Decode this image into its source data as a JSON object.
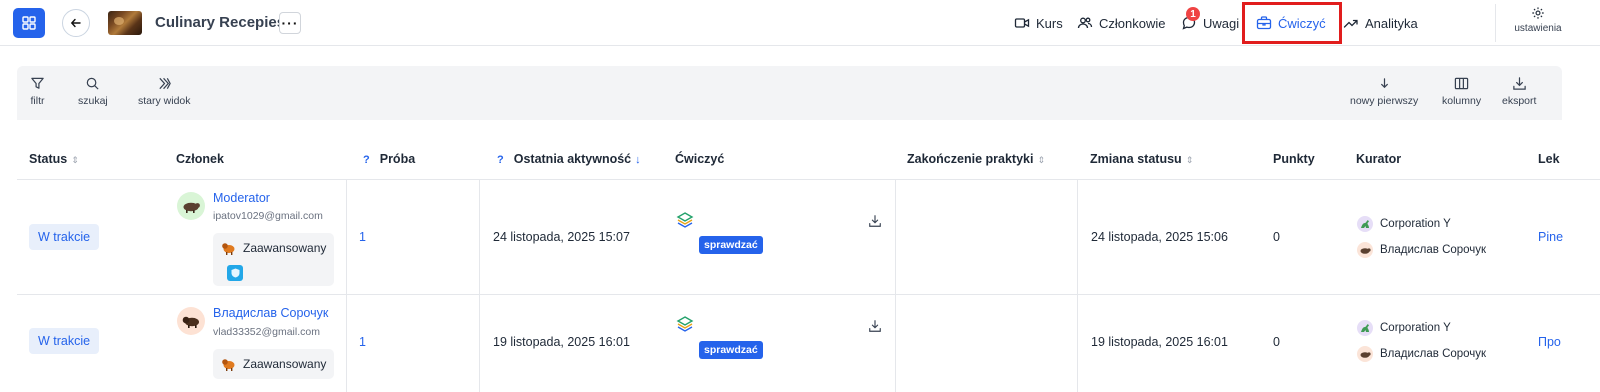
{
  "header": {
    "course_title": "Culinary Recepies",
    "nav": [
      {
        "label": "Kurs",
        "icon": "video-icon"
      },
      {
        "label": "Członkowie",
        "icon": "users-icon"
      },
      {
        "label": "Uwagi",
        "icon": "comment-icon",
        "badge": "1"
      },
      {
        "label": "Ćwiczyć",
        "icon": "briefcase-icon",
        "active": true
      },
      {
        "label": "Analityka",
        "icon": "trend-icon"
      }
    ],
    "settings_label": "ustawienia"
  },
  "toolbar": {
    "filter": "filtr",
    "search": "szukaj",
    "old_view": "stary widok",
    "newest_first": "nowy pierwszy",
    "columns": "kolumny",
    "export": "eksport"
  },
  "table": {
    "columns": {
      "status": "Status",
      "member": "Członek",
      "attempt_q": "?",
      "attempt": "Próba",
      "last_activity_q": "?",
      "last_activity": "Ostatnia aktywność",
      "practice": "Ćwiczyć",
      "practice_end": "Zakończenie praktyki",
      "status_change": "Zmiana statusu",
      "points": "Punkty",
      "curator": "Kurator",
      "lesson": "Lek"
    },
    "rows": [
      {
        "status": "W trakcie",
        "name": "Moderator",
        "email": "ipatov1029@gmail.com",
        "level": "Zaawansowany",
        "attempt": "1",
        "last_activity": "24 listopada, 2025 15:07",
        "check_label": "sprawdzać",
        "status_change": "24 listopada, 2025 15:06",
        "points": "0",
        "curators": [
          "Corporation Y",
          "Владислав Сорочук"
        ],
        "lesson": "Pine"
      },
      {
        "status": "W trakcie",
        "name": "Владислав Сорочук",
        "email": "vlad33352@gmail.com",
        "level": "Zaawansowany",
        "attempt": "1",
        "last_activity": "19 listopada, 2025 16:01",
        "check_label": "sprawdzać",
        "status_change": "19 listopada, 2025 16:01",
        "points": "0",
        "curators": [
          "Corporation Y",
          "Владислав Сорочук"
        ],
        "lesson": "Про"
      }
    ]
  },
  "colors": {
    "accent": "#2563eb",
    "highlight": "#e11d1d",
    "badge": "#ef4444"
  }
}
